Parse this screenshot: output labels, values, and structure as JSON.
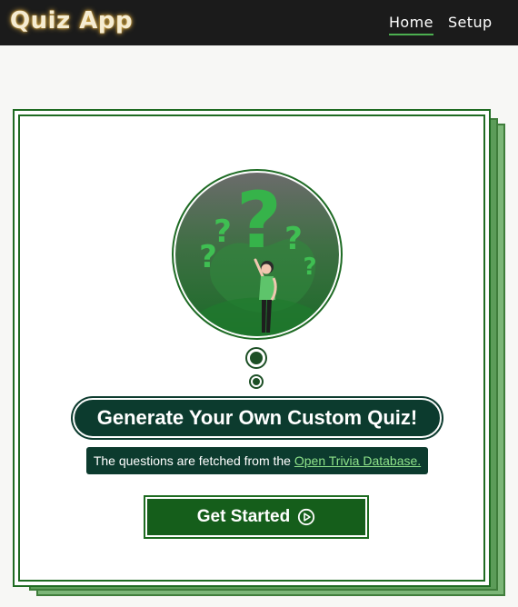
{
  "navbar": {
    "brand": "Quiz App",
    "links": [
      {
        "label": "Home",
        "active": true
      },
      {
        "label": "Setup",
        "active": false
      }
    ]
  },
  "hero": {
    "illustration": "person-with-question-marks-illustration"
  },
  "main": {
    "headline": "Generate Your Own Custom Quiz!",
    "subtitle_prefix": "The questions are fetched from the ",
    "subtitle_link": "Open Trivia Database.",
    "cta_label": "Get Started",
    "cta_icon": "play-circle-icon"
  },
  "colors": {
    "navbar_bg": "#1b1b1b",
    "brand_glow": "#e9b949",
    "accent_green": "#1f6b22",
    "dark_teal": "#0c3b2e",
    "link_green": "#8fe38a",
    "active_underline": "#4caf50"
  }
}
